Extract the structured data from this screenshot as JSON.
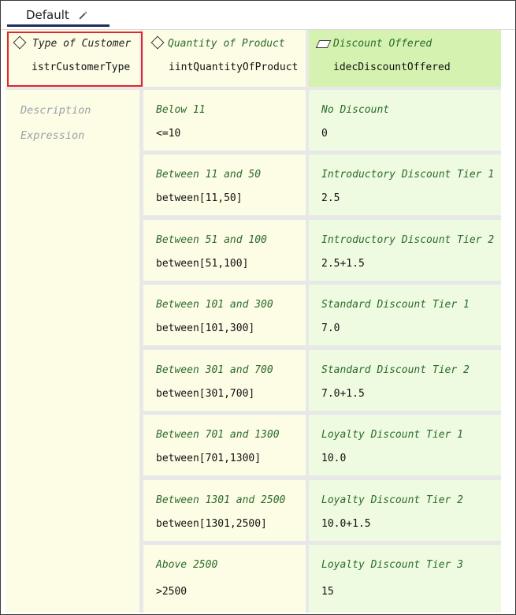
{
  "tab": {
    "label": "Default",
    "edit_icon": "pencil-icon"
  },
  "columns": [
    {
      "title": "Type of Customer",
      "variable": "istrCustomerType",
      "icon": "diamond-icon"
    },
    {
      "title": "Quantity of Product",
      "variable": "iintQuantityOfProduct",
      "icon": "diamond-icon"
    },
    {
      "title": "Discount Offered",
      "variable": "idecDiscountOffered",
      "icon": "parallelogram-icon"
    }
  ],
  "left_labels": {
    "description": "Description",
    "expression": "Expression"
  },
  "rows": [
    {
      "qty_desc": "Below 11",
      "qty_expr": "<=10",
      "disc_desc": "No Discount",
      "disc_expr": "0"
    },
    {
      "qty_desc": "Between 11 and 50",
      "qty_expr": "between[11,50]",
      "disc_desc": "Introductory Discount Tier 1",
      "disc_expr": "2.5"
    },
    {
      "qty_desc": "Between 51 and 100",
      "qty_expr": "between[51,100]",
      "disc_desc": "Introductory Discount Tier 2",
      "disc_expr": "2.5+1.5"
    },
    {
      "qty_desc": "Between 101 and 300",
      "qty_expr": "between[101,300]",
      "disc_desc": "Standard Discount Tier 1",
      "disc_expr": "7.0"
    },
    {
      "qty_desc": "Between 301 and 700",
      "qty_expr": "between[301,700]",
      "disc_desc": "Standard Discount Tier 2",
      "disc_expr": "7.0+1.5"
    },
    {
      "qty_desc": "Between 701 and 1300",
      "qty_expr": "between[701,1300]",
      "disc_desc": "Loyalty Discount Tier 1",
      "disc_expr": "10.0"
    },
    {
      "qty_desc": "Between 1301 and 2500",
      "qty_expr": "between[1301,2500]",
      "disc_desc": "Loyalty Discount Tier 2",
      "disc_expr": "10.0+1.5"
    },
    {
      "qty_desc": "Above 2500",
      "qty_expr": ">2500",
      "disc_desc": "Loyalty Discount Tier 3",
      "disc_expr": "15"
    }
  ],
  "colors": {
    "highlight": "#e0262e",
    "condition_bg": "#fdfde6",
    "action_header_bg": "#d5f2b0",
    "action_cell_bg": "#eefbe0",
    "description_text": "#2b6a2b"
  }
}
